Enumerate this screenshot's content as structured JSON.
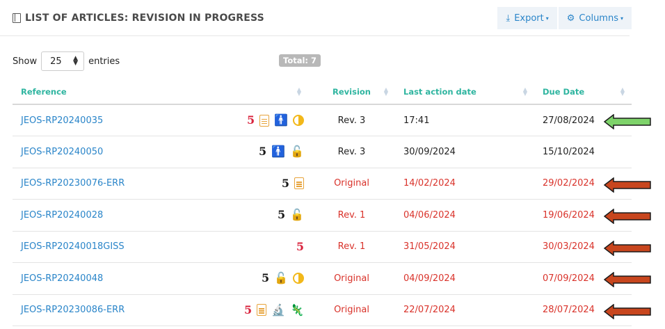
{
  "header": {
    "title": "LIST OF ARTICLES: REVISION IN PROGRESS",
    "export_label": "Export",
    "columns_label": "Columns"
  },
  "controls": {
    "show_label": "Show",
    "entries_value": "25",
    "entries_label": "entries",
    "total_badge": "Total: 7"
  },
  "table": {
    "columns": [
      "Reference",
      "",
      "Revision",
      "Last action date",
      "Due Date"
    ],
    "rows": [
      {
        "reference": "JEOS-RP20240035",
        "icons": [
          "five-red",
          "doc",
          "person",
          "half"
        ],
        "revision": "Rev. 3",
        "last_action": "17:41",
        "due": "27/08/2024",
        "overdue": false,
        "arrow": "green"
      },
      {
        "reference": "JEOS-RP20240050",
        "icons": [
          "five-black",
          "person",
          "lock"
        ],
        "revision": "Rev. 3",
        "last_action": "30/09/2024",
        "due": "15/10/2024",
        "overdue": false,
        "arrow": "none"
      },
      {
        "reference": "JEOS-RP20230076-ERR",
        "icons": [
          "five-black",
          "doc"
        ],
        "revision": "Original",
        "last_action": "14/02/2024",
        "due": "29/02/2024",
        "overdue": true,
        "arrow": "red"
      },
      {
        "reference": "JEOS-RP20240028",
        "icons": [
          "five-black",
          "lock"
        ],
        "revision": "Rev. 1",
        "last_action": "04/06/2024",
        "due": "19/06/2024",
        "overdue": true,
        "arrow": "red"
      },
      {
        "reference": "JEOS-RP20240018GISS",
        "icons": [
          "five-red"
        ],
        "revision": "Rev. 1",
        "last_action": "31/05/2024",
        "due": "30/03/2024",
        "overdue": true,
        "arrow": "red"
      },
      {
        "reference": "JEOS-RP20240048",
        "icons": [
          "five-black",
          "lock",
          "half"
        ],
        "revision": "Original",
        "last_action": "04/09/2024",
        "due": "07/09/2024",
        "overdue": true,
        "arrow": "red"
      },
      {
        "reference": "JEOS-RP20230086-ERR",
        "icons": [
          "five-red",
          "doc",
          "microscope",
          "lizard"
        ],
        "revision": "Original",
        "last_action": "22/07/2024",
        "due": "28/07/2024",
        "overdue": true,
        "arrow": "red"
      }
    ]
  },
  "colors": {
    "accent_teal": "#2fb5a0",
    "link_blue": "#2a85c9",
    "overdue_red": "#d9322a",
    "arrow_green": "#7ed36a",
    "arrow_red": "#c8461e"
  }
}
